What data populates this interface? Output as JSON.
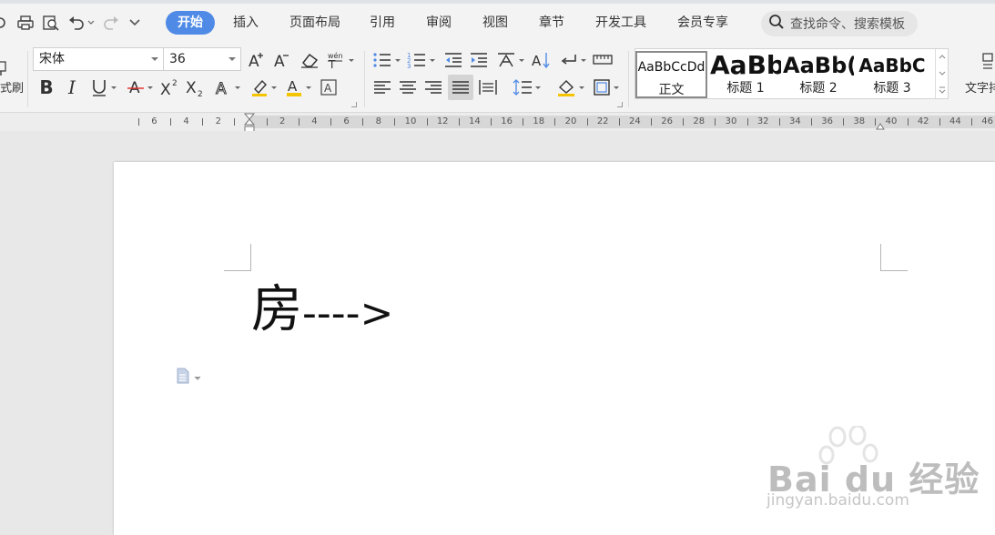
{
  "tabs": [
    {
      "label": "开始",
      "active": true
    },
    {
      "label": "插入"
    },
    {
      "label": "页面布局"
    },
    {
      "label": "引用"
    },
    {
      "label": "审阅"
    },
    {
      "label": "视图"
    },
    {
      "label": "章节"
    },
    {
      "label": "开发工具"
    },
    {
      "label": "会员专享"
    }
  ],
  "search": {
    "placeholder": "查找命令、搜索模板"
  },
  "ribbon": {
    "format_painter_label": "式刷",
    "font_name": "宋体",
    "font_size": "36",
    "text_layout_label": "文字排",
    "styles": [
      {
        "sample": "AaBbCcDd",
        "label": "正文"
      },
      {
        "sample": "AaBb",
        "label": "标题 1"
      },
      {
        "sample": "AaBb(",
        "label": "标题 2"
      },
      {
        "sample": "AaBbC",
        "label": "标题 3"
      }
    ]
  },
  "ruler": {
    "labels": [
      "6",
      "4",
      "2",
      "2",
      "4",
      "6",
      "8",
      "10",
      "12",
      "14",
      "16",
      "18",
      "20",
      "22",
      "24",
      "26",
      "28",
      "30",
      "32",
      "34",
      "36",
      "38",
      "40",
      "42",
      "44",
      "46"
    ]
  },
  "document": {
    "text_char": "房",
    "text_arrow": "---->"
  },
  "watermark": {
    "brand": "Bai du 经验",
    "url": "jingyan.baidu.com"
  },
  "colors": {
    "accent": "#4f8ae6",
    "font_color_bar": "#f5c400",
    "highlight_bar": "#f5c400",
    "underline_red": "#e53935"
  }
}
